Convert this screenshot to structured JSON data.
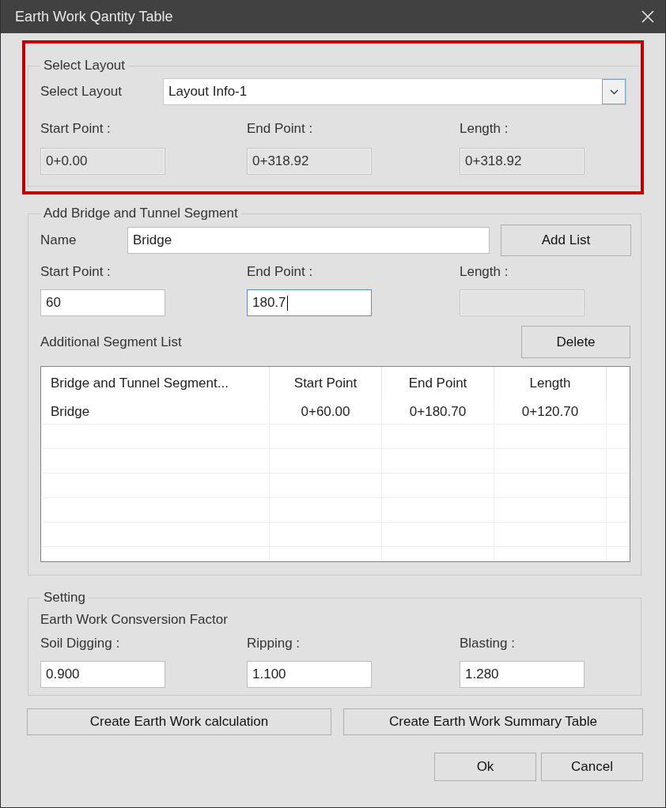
{
  "window": {
    "title": "Earth Work Qantity Table"
  },
  "select_layout": {
    "title": "Select Layout",
    "highlighted": true,
    "label": "Select Layout",
    "dropdown": {
      "value": "Layout Info-1"
    },
    "fields": [
      {
        "label": "Start Point :",
        "value": "0+0.00",
        "readonly": true
      },
      {
        "label": "End Point :",
        "value": "0+318.92",
        "readonly": true
      },
      {
        "label": "Length :",
        "value": "0+318.92",
        "readonly": true
      }
    ]
  },
  "segment": {
    "title": "Add Bridge and Tunnel Segment",
    "name_label": "Name",
    "name_value": "Bridge",
    "add_button": "Add List",
    "fields": [
      {
        "label": "Start Point :",
        "value": "60",
        "readonly": false,
        "focused": false
      },
      {
        "label": "End Point :",
        "value": "180.7",
        "readonly": false,
        "focused": true
      },
      {
        "label": "Length :",
        "readonly": true,
        "focused": false
      }
    ],
    "list_label": "Additional Segment List",
    "delete_button": "Delete",
    "table": {
      "columns": [
        "Bridge and Tunnel Segment...",
        "Start Point",
        "End Point",
        "Length"
      ],
      "rows": [
        [
          "Bridge",
          "0+60.00",
          "0+180.70",
          "0+120.70"
        ]
      ]
    }
  },
  "setting": {
    "title": "Setting",
    "subtitle": "Earth Work Consversion Factor",
    "fields": [
      {
        "label": "Soil Digging :",
        "value": "0.900",
        "readonly": false
      },
      {
        "label": "Ripping :",
        "value": "1.100",
        "readonly": false
      },
      {
        "label": "Blasting :",
        "value": "1.280",
        "readonly": false
      }
    ]
  },
  "actions": [
    "Create Earth Work calculation",
    "Create Earth Work Summary Table"
  ],
  "dialog_buttons": [
    "Ok",
    "Cancel"
  ]
}
